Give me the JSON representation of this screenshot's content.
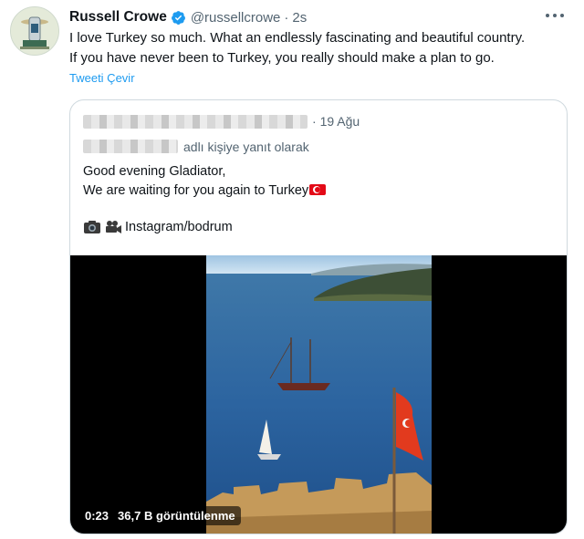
{
  "tweet": {
    "author_name": "Russell Crowe",
    "handle": "@russellcrowe",
    "separator": "·",
    "time": "2s",
    "text_lines": [
      "I love Turkey so much. What an endlessly fascinating and beautiful country.",
      "If you have never been to Turkey, you really should make a plan to go."
    ],
    "translate_link": "Tweeti Çevir"
  },
  "quote": {
    "separator": "·",
    "date": "19 Ağu",
    "reply_context": "adlı kişiye yanıt olarak",
    "text_lines": [
      "Good evening Gladiator,",
      "We are waiting for you again to Turkey"
    ],
    "media_credit": "Instagram/bodrum",
    "video": {
      "duration": "0:23",
      "views": "36,7 B görüntülenme"
    }
  },
  "colors": {
    "accent": "#1d9bf0",
    "text_primary": "#0f1419",
    "text_secondary": "#536471",
    "border": "#cfd9de",
    "flag_red": "#e30a17"
  },
  "icons": [
    "verified-badge-icon",
    "more-options-icon",
    "camera-icon",
    "video-camera-icon",
    "turkey-flag-icon"
  ]
}
